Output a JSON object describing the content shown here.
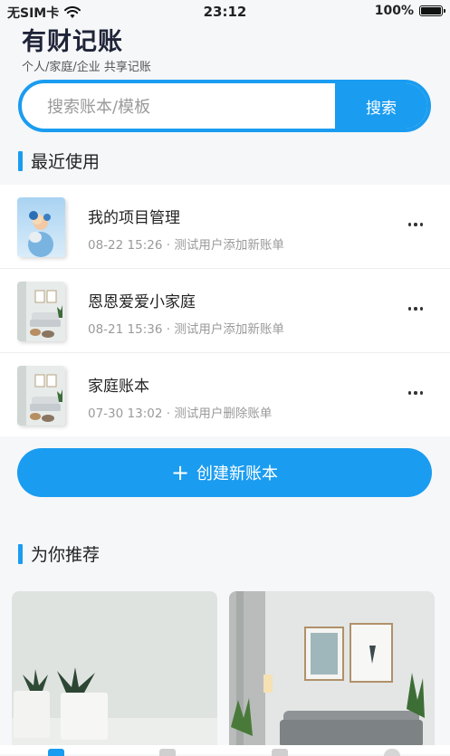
{
  "status_bar": {
    "carrier": "无SIM卡",
    "time": "23:12",
    "battery": "100%"
  },
  "header": {
    "title": "有财记账",
    "subtitle": "个人/家庭/企业 共享记账"
  },
  "search": {
    "placeholder": "搜索账本/模板",
    "button_label": "搜索"
  },
  "recent": {
    "section_title": "最近使用",
    "items": [
      {
        "name": "我的项目管理",
        "date": "08-22 15:26",
        "activity": "测试用户添加新账单"
      },
      {
        "name": "恩恩爱爱小家庭",
        "date": "08-21 15:36",
        "activity": "测试用户添加新账单"
      },
      {
        "name": "家庭账本",
        "date": "07-30 13:02",
        "activity": "测试用户删除账单"
      }
    ]
  },
  "create_button": {
    "label": "创建新账本",
    "icon": "plus-icon"
  },
  "recommend": {
    "section_title": "为你推荐"
  },
  "colors": {
    "accent": "#1a9cf0",
    "title": "#1f2438",
    "muted": "#9a9a9a"
  }
}
